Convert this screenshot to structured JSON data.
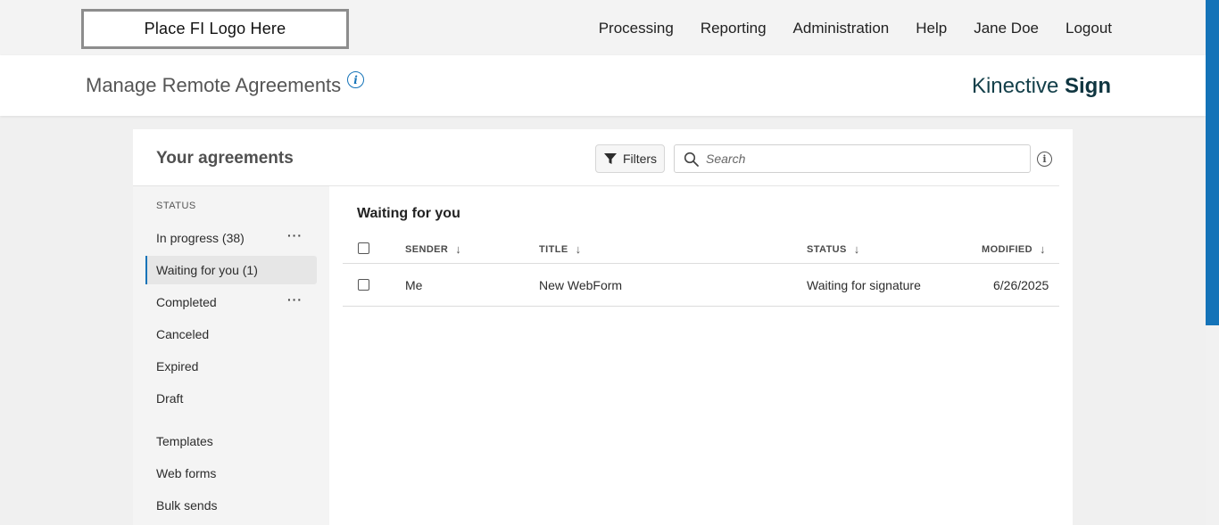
{
  "topnav": {
    "logo_text": "Place FI Logo Here",
    "items": [
      "Processing",
      "Reporting",
      "Administration",
      "Help",
      "Jane Doe",
      "Logout"
    ]
  },
  "header": {
    "title": "Manage Remote Agreements",
    "info_glyph": "i",
    "brand_regular": "Kinective ",
    "brand_bold": "Sign"
  },
  "card": {
    "title": "Your agreements",
    "filters_label": "Filters",
    "search_placeholder": "Search"
  },
  "sidebar": {
    "status_label": "STATUS",
    "items": [
      {
        "label": "In progress (38)",
        "has_more": true
      },
      {
        "label": "Waiting for you (1)",
        "active": true
      },
      {
        "label": "Completed",
        "has_more": true
      },
      {
        "label": "Canceled"
      },
      {
        "label": "Expired"
      },
      {
        "label": "Draft"
      },
      {
        "label": "Templates"
      },
      {
        "label": "Web forms"
      },
      {
        "label": "Bulk sends"
      }
    ]
  },
  "table": {
    "section_title": "Waiting for you",
    "columns": [
      "SENDER",
      "TITLE",
      "STATUS",
      "MODIFIED"
    ],
    "rows": [
      {
        "sender": "Me",
        "title": "New WebForm",
        "status": "Waiting for signature",
        "modified": "6/26/2025"
      }
    ]
  },
  "colors": {
    "accent": "#1473b8",
    "brand": "#14404a"
  }
}
